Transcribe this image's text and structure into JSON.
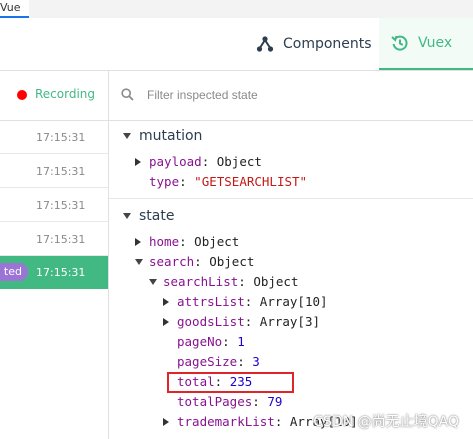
{
  "browser_tab": {
    "label": "Vue"
  },
  "header": {
    "components_label": "Components",
    "vuex_label": "Vuex",
    "accent_color": "#42b983"
  },
  "left_panel": {
    "recording_label": "Recording",
    "rows": [
      {
        "time": "17:15:31"
      },
      {
        "time": "17:15:31"
      },
      {
        "time": "17:15:31"
      },
      {
        "time": "17:15:31"
      },
      {
        "time": "17:15:31",
        "badge": "ted",
        "active": true
      }
    ]
  },
  "filter": {
    "placeholder": "Filter inspected state"
  },
  "mutation": {
    "title": "mutation",
    "payload_key": "payload",
    "payload_value": "Object",
    "type_key": "type",
    "type_value": "\"GETSEARCHLIST\""
  },
  "state": {
    "title": "state",
    "home_key": "home",
    "home_value": "Object",
    "search_key": "search",
    "search_value": "Object",
    "searchList_key": "searchList",
    "searchList_value": "Object",
    "attrsList_key": "attrsList",
    "attrsList_value": "Array[10]",
    "goodsList_key": "goodsList",
    "goodsList_value": "Array[3]",
    "pageNo_key": "pageNo",
    "pageNo_value": "1",
    "pageSize_key": "pageSize",
    "pageSize_value": "3",
    "total_key": "total",
    "total_value": "235",
    "totalPages_key": "totalPages",
    "totalPages_value": "79",
    "trademarkList_key": "trademarkList",
    "trademarkList_value": "Array[10]"
  },
  "watermark": "CSDN @尚无止境QAQ"
}
